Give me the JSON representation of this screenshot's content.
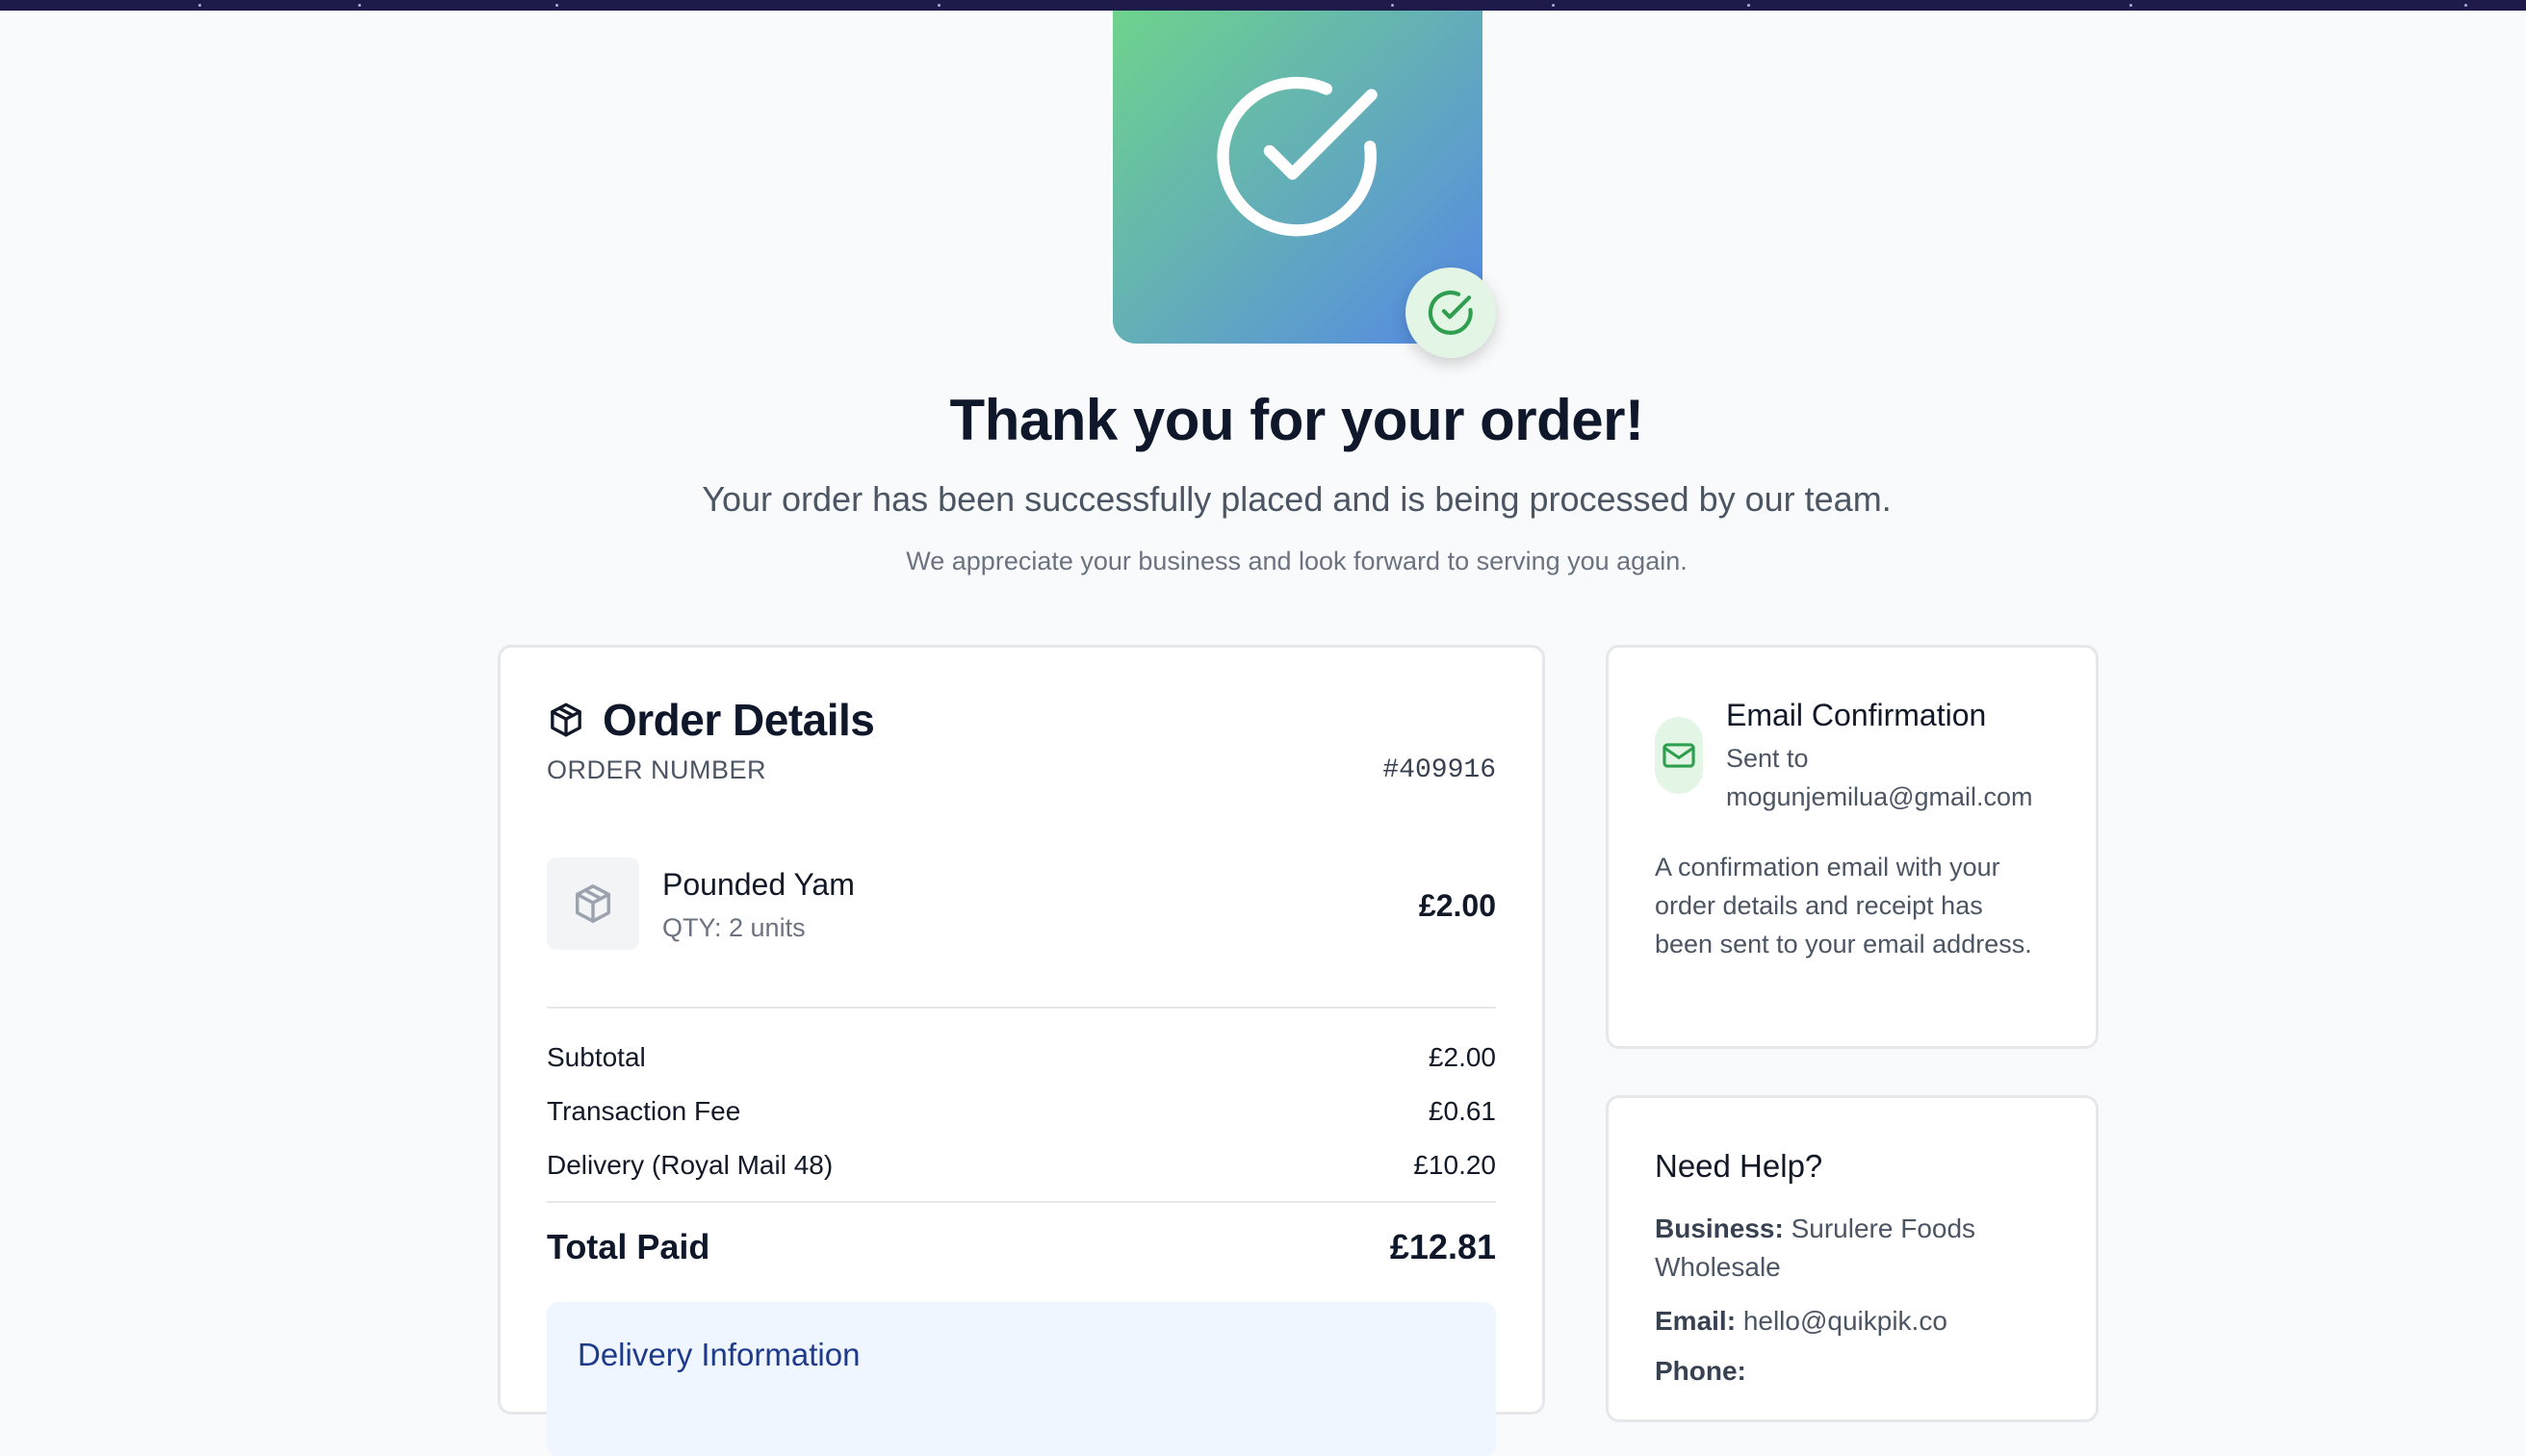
{
  "colors": {
    "accent_green": "#2f9e4f",
    "hero_gradient_start": "#6ed38c",
    "hero_gradient_end": "#5488e6",
    "delivery_bg": "#eff6ff",
    "delivery_title": "#1e3a8a"
  },
  "icons": {
    "hero": "check-circle-icon",
    "badge": "check-circle-icon",
    "order": "package-icon",
    "item": "package-icon",
    "email": "mail-icon"
  },
  "header": {
    "title": "Thank you for your order!",
    "subtitle": "Your order has been successfully placed and is being processed by our team.",
    "subtext": "We appreciate your business and look forward to serving you again."
  },
  "order": {
    "title": "Order Details",
    "number_label": "ORDER NUMBER",
    "number_value": "#409916",
    "items": [
      {
        "name": "Pounded Yam",
        "qty": "QTY: 2 units",
        "price": "£2.00"
      }
    ],
    "summary": [
      {
        "label": "Subtotal",
        "value": "£2.00"
      },
      {
        "label": "Transaction Fee",
        "value": "£0.61"
      },
      {
        "label": "Delivery (Royal Mail 48)",
        "value": "£10.20"
      }
    ],
    "total_label": "Total Paid",
    "total_value": "£12.81",
    "delivery_title": "Delivery Information"
  },
  "email": {
    "title": "Email Confirmation",
    "sent_label": "Sent to",
    "address": "mogunjemilua@gmail.com",
    "body": "A confirmation email with your order details and receipt has been sent to your email address."
  },
  "help": {
    "title": "Need Help?",
    "business_label": "Business:",
    "business_value": "Surulere Foods Wholesale",
    "email_label": "Email:",
    "email_value": "hello@quikpik.co",
    "phone_label": "Phone:"
  }
}
